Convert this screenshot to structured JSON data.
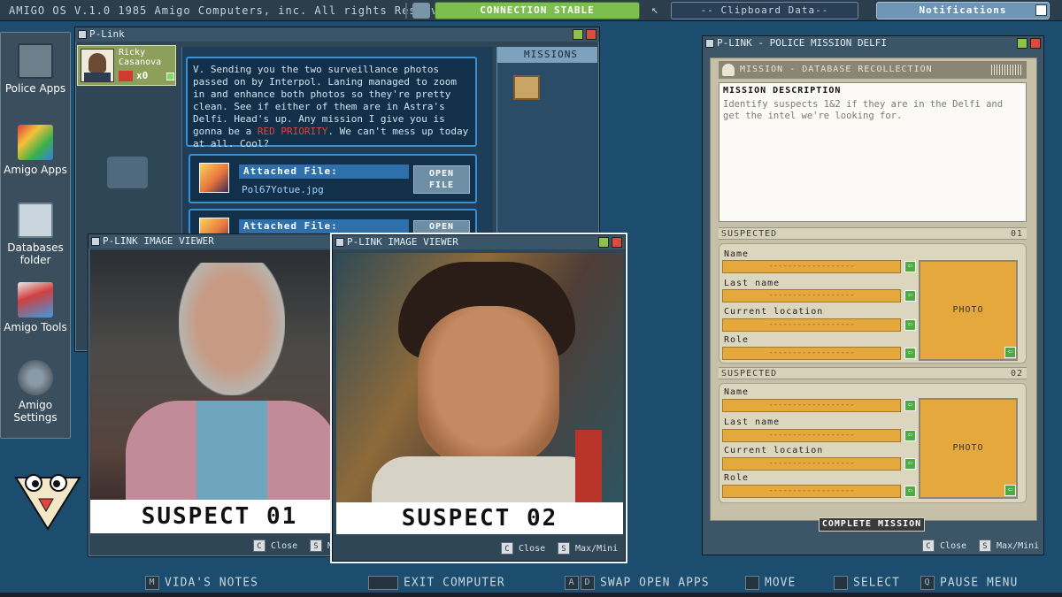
{
  "topbar": {
    "title": "AMIGO OS  V.1.0 1985 Amigo Computers, inc. All rights Reserved.",
    "connection": "CONNECTION STABLE",
    "clipboard": "-- Clipboard Data--",
    "notifications": "Notifications"
  },
  "dock": {
    "items": [
      {
        "label": "Police Apps",
        "icon": "floppy-icon"
      },
      {
        "label": "Amigo Apps",
        "icon": "apps-icon"
      },
      {
        "label": "Databases folder",
        "icon": "fingerprint-icon"
      },
      {
        "label": "Amigo Tools",
        "icon": "tools-icon"
      },
      {
        "label": "Amigo Settings",
        "icon": "gear-icon"
      }
    ]
  },
  "plink": {
    "title": "P-Link",
    "user": {
      "first": "Ricky",
      "last": "Casanova",
      "count": "x0"
    },
    "message_a": "V. Sending you the two surveillance photos passed on by Interpol. Laning managed to zoom in and enhance both photos so they're pretty clean. See if either of them are in Astra's Delfi. Head's up. Any mission I give you is gonna be a ",
    "message_red": "RED PRIORITY",
    "message_b": ". We can't mess up today at all. Cool?",
    "attach_label": "Attached File:",
    "file1": "Pol67Yotue.jpg",
    "open_label": "OPEN FILE",
    "open_label_short": "OPEN",
    "missions_label": "MISSIONS"
  },
  "viewer1": {
    "title": "P-LINK IMAGE VIEWER",
    "caption": "SUSPECT 01",
    "close": "Close",
    "close_key": "C",
    "max_key": "S",
    "max": "M"
  },
  "viewer2": {
    "title": "P-LINK IMAGE VIEWER",
    "caption": "SUSPECT 02",
    "close": "Close",
    "close_key": "C",
    "max_key": "S",
    "max": "Max/Mini"
  },
  "mission": {
    "title": "P-LINK - POLICE MISSION DELFI",
    "header": "MISSION - DATABASE RECOLLECTION",
    "desc_title": "MISSION DESCRIPTION",
    "desc_body": "Identify suspects 1&2 if they are in the Delfi and get the intel we're looking for.",
    "suspected": "SUSPECTED",
    "s1_num": "01",
    "s2_num": "02",
    "labels": {
      "name": "Name",
      "last": "Last name",
      "location": "Current location",
      "role": "Role"
    },
    "placeholder": "------------------",
    "photo": "PHOTO",
    "complete": "COMPLETE MISSION",
    "close": "Close",
    "max": "Max/Mini",
    "close_key": "C",
    "max_key": "S"
  },
  "bottom": {
    "notes": "VIDA'S NOTES",
    "notes_key": "M",
    "exit": "EXIT COMPUTER",
    "swap": "SWAP OPEN APPS",
    "swap_k1": "A",
    "swap_k2": "D",
    "move": "MOVE",
    "select": "SELECT",
    "pause": "PAUSE MENU",
    "pause_key": "Q"
  }
}
